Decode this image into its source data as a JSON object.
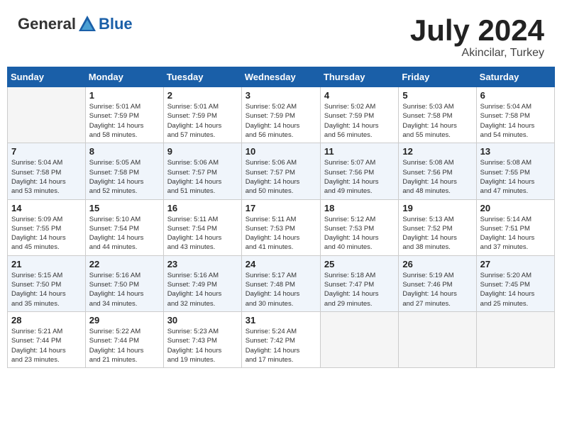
{
  "header": {
    "logo_general": "General",
    "logo_blue": "Blue",
    "title": "July 2024",
    "location": "Akincilar, Turkey"
  },
  "calendar": {
    "days_of_week": [
      "Sunday",
      "Monday",
      "Tuesday",
      "Wednesday",
      "Thursday",
      "Friday",
      "Saturday"
    ],
    "weeks": [
      [
        {
          "day": "",
          "info": ""
        },
        {
          "day": "1",
          "info": "Sunrise: 5:01 AM\nSunset: 7:59 PM\nDaylight: 14 hours\nand 58 minutes."
        },
        {
          "day": "2",
          "info": "Sunrise: 5:01 AM\nSunset: 7:59 PM\nDaylight: 14 hours\nand 57 minutes."
        },
        {
          "day": "3",
          "info": "Sunrise: 5:02 AM\nSunset: 7:59 PM\nDaylight: 14 hours\nand 56 minutes."
        },
        {
          "day": "4",
          "info": "Sunrise: 5:02 AM\nSunset: 7:59 PM\nDaylight: 14 hours\nand 56 minutes."
        },
        {
          "day": "5",
          "info": "Sunrise: 5:03 AM\nSunset: 7:58 PM\nDaylight: 14 hours\nand 55 minutes."
        },
        {
          "day": "6",
          "info": "Sunrise: 5:04 AM\nSunset: 7:58 PM\nDaylight: 14 hours\nand 54 minutes."
        }
      ],
      [
        {
          "day": "7",
          "info": "Sunrise: 5:04 AM\nSunset: 7:58 PM\nDaylight: 14 hours\nand 53 minutes."
        },
        {
          "day": "8",
          "info": "Sunrise: 5:05 AM\nSunset: 7:58 PM\nDaylight: 14 hours\nand 52 minutes."
        },
        {
          "day": "9",
          "info": "Sunrise: 5:06 AM\nSunset: 7:57 PM\nDaylight: 14 hours\nand 51 minutes."
        },
        {
          "day": "10",
          "info": "Sunrise: 5:06 AM\nSunset: 7:57 PM\nDaylight: 14 hours\nand 50 minutes."
        },
        {
          "day": "11",
          "info": "Sunrise: 5:07 AM\nSunset: 7:56 PM\nDaylight: 14 hours\nand 49 minutes."
        },
        {
          "day": "12",
          "info": "Sunrise: 5:08 AM\nSunset: 7:56 PM\nDaylight: 14 hours\nand 48 minutes."
        },
        {
          "day": "13",
          "info": "Sunrise: 5:08 AM\nSunset: 7:55 PM\nDaylight: 14 hours\nand 47 minutes."
        }
      ],
      [
        {
          "day": "14",
          "info": "Sunrise: 5:09 AM\nSunset: 7:55 PM\nDaylight: 14 hours\nand 45 minutes."
        },
        {
          "day": "15",
          "info": "Sunrise: 5:10 AM\nSunset: 7:54 PM\nDaylight: 14 hours\nand 44 minutes."
        },
        {
          "day": "16",
          "info": "Sunrise: 5:11 AM\nSunset: 7:54 PM\nDaylight: 14 hours\nand 43 minutes."
        },
        {
          "day": "17",
          "info": "Sunrise: 5:11 AM\nSunset: 7:53 PM\nDaylight: 14 hours\nand 41 minutes."
        },
        {
          "day": "18",
          "info": "Sunrise: 5:12 AM\nSunset: 7:53 PM\nDaylight: 14 hours\nand 40 minutes."
        },
        {
          "day": "19",
          "info": "Sunrise: 5:13 AM\nSunset: 7:52 PM\nDaylight: 14 hours\nand 38 minutes."
        },
        {
          "day": "20",
          "info": "Sunrise: 5:14 AM\nSunset: 7:51 PM\nDaylight: 14 hours\nand 37 minutes."
        }
      ],
      [
        {
          "day": "21",
          "info": "Sunrise: 5:15 AM\nSunset: 7:50 PM\nDaylight: 14 hours\nand 35 minutes."
        },
        {
          "day": "22",
          "info": "Sunrise: 5:16 AM\nSunset: 7:50 PM\nDaylight: 14 hours\nand 34 minutes."
        },
        {
          "day": "23",
          "info": "Sunrise: 5:16 AM\nSunset: 7:49 PM\nDaylight: 14 hours\nand 32 minutes."
        },
        {
          "day": "24",
          "info": "Sunrise: 5:17 AM\nSunset: 7:48 PM\nDaylight: 14 hours\nand 30 minutes."
        },
        {
          "day": "25",
          "info": "Sunrise: 5:18 AM\nSunset: 7:47 PM\nDaylight: 14 hours\nand 29 minutes."
        },
        {
          "day": "26",
          "info": "Sunrise: 5:19 AM\nSunset: 7:46 PM\nDaylight: 14 hours\nand 27 minutes."
        },
        {
          "day": "27",
          "info": "Sunrise: 5:20 AM\nSunset: 7:45 PM\nDaylight: 14 hours\nand 25 minutes."
        }
      ],
      [
        {
          "day": "28",
          "info": "Sunrise: 5:21 AM\nSunset: 7:44 PM\nDaylight: 14 hours\nand 23 minutes."
        },
        {
          "day": "29",
          "info": "Sunrise: 5:22 AM\nSunset: 7:44 PM\nDaylight: 14 hours\nand 21 minutes."
        },
        {
          "day": "30",
          "info": "Sunrise: 5:23 AM\nSunset: 7:43 PM\nDaylight: 14 hours\nand 19 minutes."
        },
        {
          "day": "31",
          "info": "Sunrise: 5:24 AM\nSunset: 7:42 PM\nDaylight: 14 hours\nand 17 minutes."
        },
        {
          "day": "",
          "info": ""
        },
        {
          "day": "",
          "info": ""
        },
        {
          "day": "",
          "info": ""
        }
      ]
    ]
  }
}
